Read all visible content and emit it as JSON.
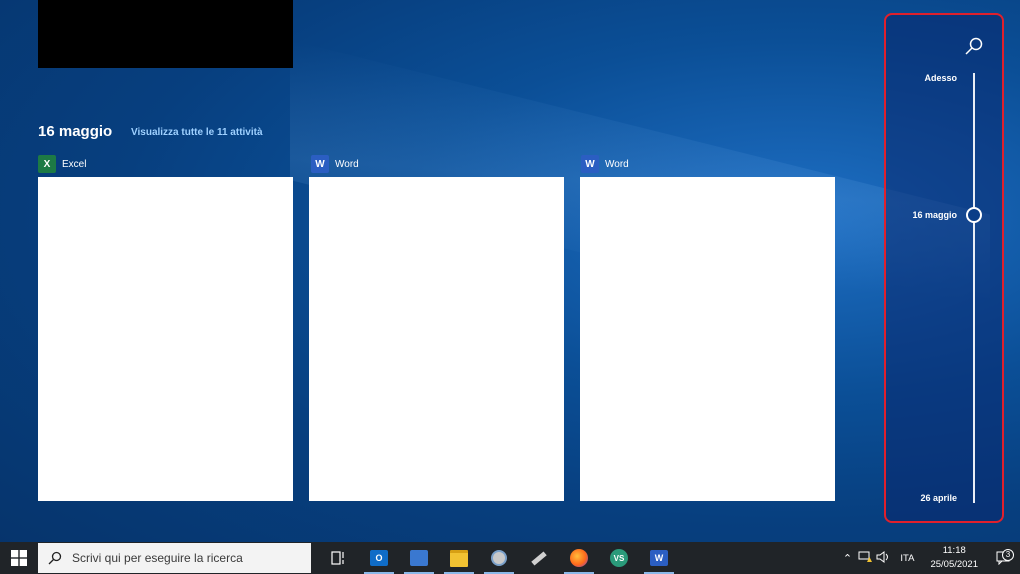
{
  "activity": {
    "date_heading": "16 maggio",
    "view_all": "Visualizza tutte le 11 attività",
    "apps": [
      {
        "name": "Excel",
        "icon": "excel-icon",
        "letter": "X"
      },
      {
        "name": "Word",
        "icon": "word-icon",
        "letter": "W"
      },
      {
        "name": "Word",
        "icon": "word-icon",
        "letter": "W"
      }
    ]
  },
  "timeline": {
    "search_icon": "search-icon",
    "labels": [
      "Adesso",
      "16 maggio",
      "26 aprile"
    ]
  },
  "taskbar": {
    "search_placeholder": "Scrivi qui per eseguire la ricerca",
    "apps": [
      "task-view-icon",
      "outlook-icon",
      "network-app-icon",
      "file-explorer-icon",
      "paint-icon",
      "usb-icon",
      "firefox-icon",
      "vs-app-icon",
      "word-icon"
    ],
    "tray": {
      "language": "ITA",
      "time": "11:18",
      "date": "25/05/2021",
      "notifications": "3"
    }
  },
  "colors": {
    "timeline_border": "#e0202c",
    "taskbar": "#202428",
    "excel": "#1d7a45",
    "word": "#2b5ec2"
  }
}
